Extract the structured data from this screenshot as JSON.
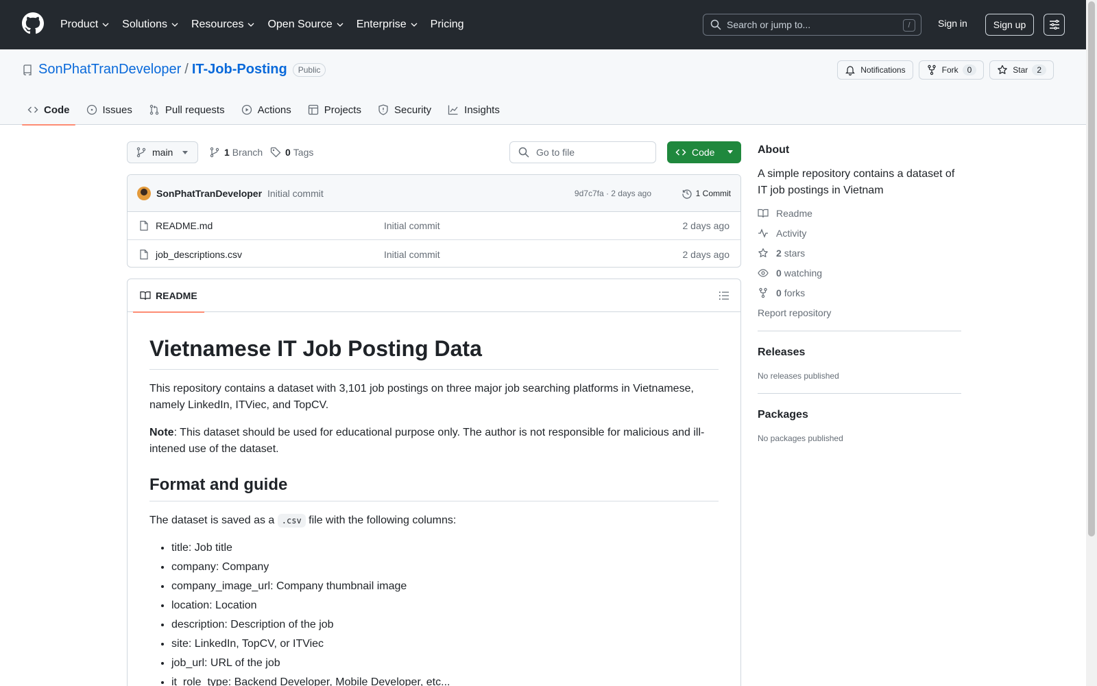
{
  "header": {
    "nav": [
      "Product",
      "Solutions",
      "Resources",
      "Open Source",
      "Enterprise",
      "Pricing"
    ],
    "search_placeholder": "Search or jump to...",
    "search_shortcut": "/",
    "sign_in": "Sign in",
    "sign_up": "Sign up"
  },
  "repo": {
    "owner": "SonPhatTranDeveloper",
    "separator": "/",
    "name": "IT-Job-Posting",
    "visibility": "Public",
    "notifications_label": "Notifications",
    "fork_label": "Fork",
    "fork_count": "0",
    "star_label": "Star",
    "star_count": "2"
  },
  "tabs": [
    {
      "label": "Code",
      "icon": "code-icon"
    },
    {
      "label": "Issues",
      "icon": "issue-icon"
    },
    {
      "label": "Pull requests",
      "icon": "pull-request-icon"
    },
    {
      "label": "Actions",
      "icon": "play-icon"
    },
    {
      "label": "Projects",
      "icon": "table-icon"
    },
    {
      "label": "Security",
      "icon": "shield-icon"
    },
    {
      "label": "Insights",
      "icon": "graph-icon"
    }
  ],
  "toolbar": {
    "branch": "main",
    "branch_count": "1",
    "branch_label": "Branch",
    "tag_count": "0",
    "tag_label": "Tags",
    "goto_placeholder": "Go to file",
    "code_label": "Code"
  },
  "latest_commit": {
    "author": "SonPhatTranDeveloper",
    "message": "Initial commit",
    "meta": "9d7c7fa · 2 days ago",
    "commits": "1 Commit"
  },
  "files": [
    {
      "name": "README.md",
      "message": "Initial commit",
      "date": "2 days ago"
    },
    {
      "name": "job_descriptions.csv",
      "message": "Initial commit",
      "date": "2 days ago"
    }
  ],
  "readme": {
    "tab_label": "README",
    "title": "Vietnamese IT Job Posting Data",
    "intro": "This repository contains a dataset with 3,101 job postings on three major job searching platforms in Vietnamese, namely LinkedIn, ITViec, and TopCV.",
    "note_label": "Note",
    "note_text": ": This dataset should be used for educational purpose only. The author is not responsible for malicious and ill-intened use of the dataset.",
    "section_title": "Format and guide",
    "format_before": "The dataset is saved as a ",
    "format_code": ".csv",
    "format_after": " file with the following columns:",
    "columns": [
      "title: Job title",
      "company: Company",
      "company_image_url: Company thumbnail image",
      "location: Location",
      "description: Description of the job",
      "site: LinkedIn, TopCV, or ITViec",
      "job_url: URL of the job",
      "it_role_type: Backend Developer, Mobile Developer, etc..."
    ]
  },
  "about": {
    "heading": "About",
    "description": "A simple repository contains a dataset of IT job postings in Vietnam",
    "readme": "Readme",
    "activity": "Activity",
    "stars_count": "2",
    "stars_label": "stars",
    "watching_count": "0",
    "watching_label": "watching",
    "forks_count": "0",
    "forks_label": "forks",
    "report": "Report repository"
  },
  "releases": {
    "heading": "Releases",
    "empty": "No releases published"
  },
  "packages": {
    "heading": "Packages",
    "empty": "No packages published"
  },
  "colors": {
    "header_bg": "#24292f",
    "link": "#0969da",
    "primary": "#1f883d",
    "tab_underline": "#fd8c73"
  }
}
